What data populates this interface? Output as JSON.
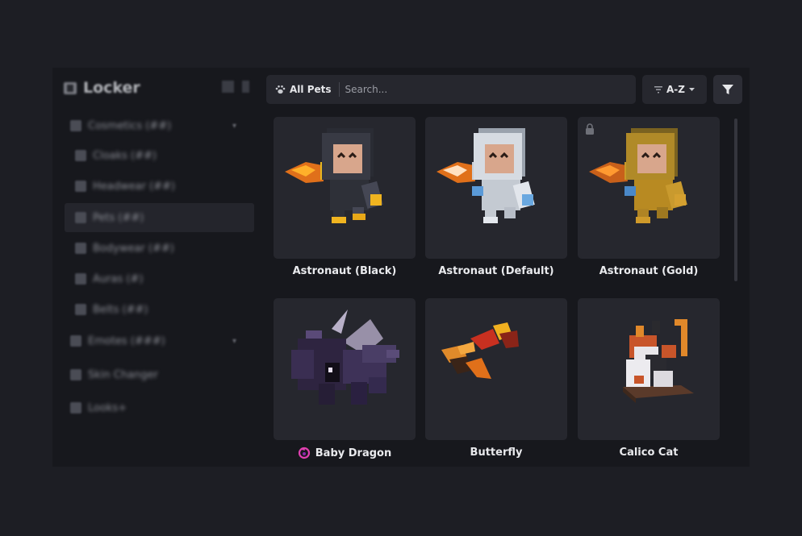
{
  "sidebar": {
    "title": "Locker",
    "items": [
      {
        "label": "Cosmetics (##)",
        "icon": "shirt-icon"
      },
      {
        "label": "Cloaks (##)",
        "icon": "cloak-icon"
      },
      {
        "label": "Headwear (##)",
        "icon": "hat-icon"
      },
      {
        "label": "Pets (##)",
        "icon": "paw-icon"
      },
      {
        "label": "Bodywear (##)",
        "icon": "glasses-icon"
      },
      {
        "label": "Auras (#)",
        "icon": "aura-icon"
      },
      {
        "label": "Belts (##)",
        "icon": "belt-icon"
      },
      {
        "label": "Emotes (###)",
        "icon": "emote-icon"
      },
      {
        "label": "Skin Changer",
        "icon": "skin-icon"
      },
      {
        "label": "Looks+",
        "icon": "looks-icon"
      }
    ]
  },
  "toolbar": {
    "category_chip": "All Pets",
    "search_placeholder": "Search...",
    "sort_label": "A-Z"
  },
  "pets": [
    {
      "name": "Astronaut (Black)",
      "locked": false
    },
    {
      "name": "Astronaut (Default)",
      "locked": false
    },
    {
      "name": "Astronaut (Gold)",
      "locked": true
    },
    {
      "name": "Baby Dragon",
      "locked": false,
      "badge": "dragon-badge-icon"
    },
    {
      "name": "Butterfly",
      "locked": false
    },
    {
      "name": "Calico Cat",
      "locked": false
    }
  ],
  "colors": {
    "background": "#1d1e24",
    "window": "#17181d",
    "card": "#26272e",
    "text": "#e9eaed",
    "badge": "#e040b0"
  }
}
